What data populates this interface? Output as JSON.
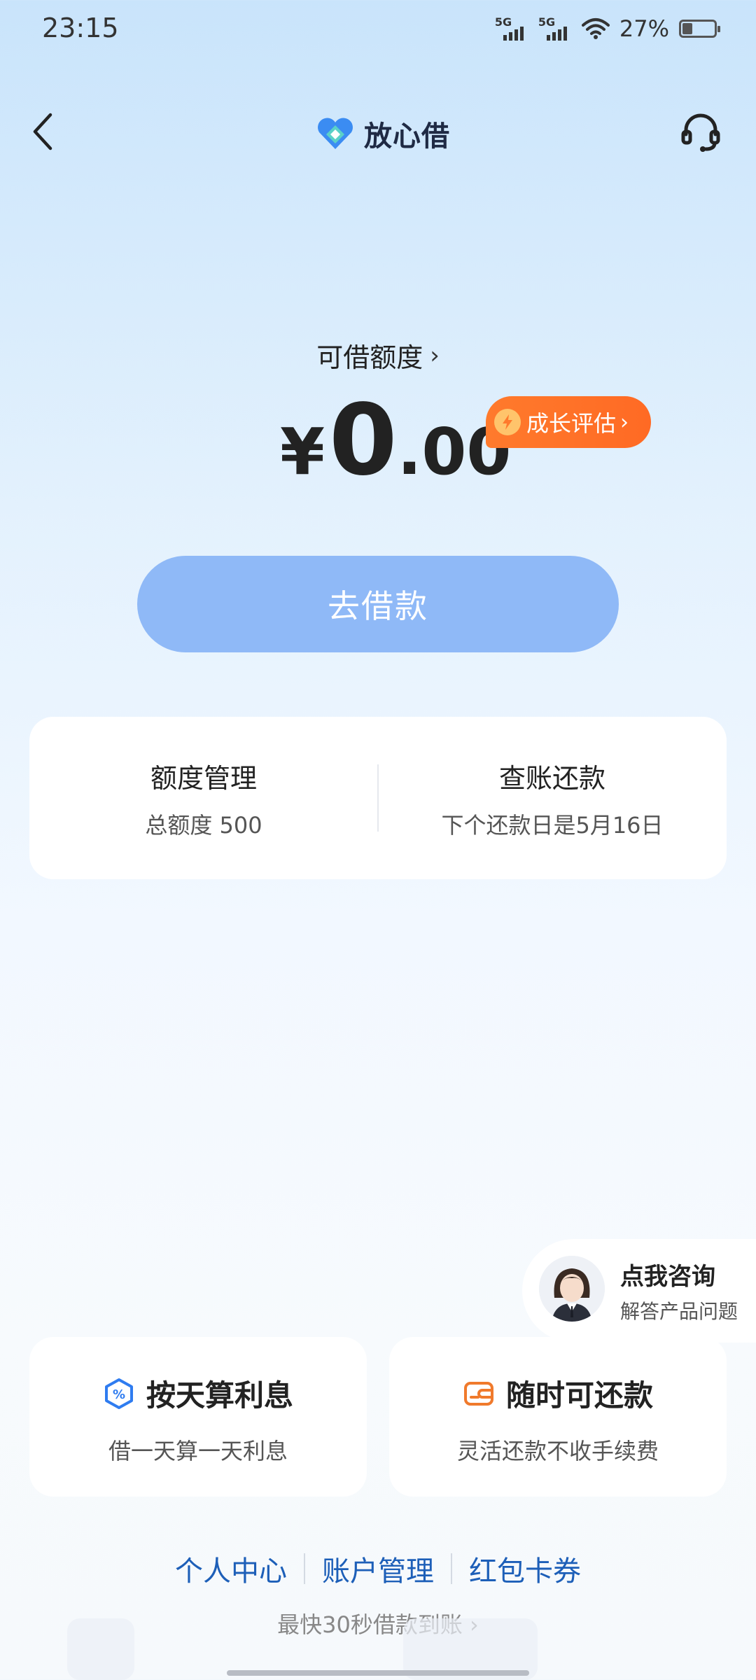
{
  "status_bar": {
    "time": "23:15",
    "signal1_label": "5G",
    "signal2_label": "5G",
    "battery_text": "27%"
  },
  "nav": {
    "brand_name": "放心借",
    "back_icon": "chevron-left-icon",
    "service_icon": "headset-icon"
  },
  "credit": {
    "label": "可借额度",
    "chevron": "›",
    "currency": "¥",
    "amount_int": "0",
    "amount_dec": ".00",
    "growth_label": "成长评估",
    "growth_chevron": "›"
  },
  "borrow_button": "去借款",
  "manage": {
    "left_title": "额度管理",
    "left_sub": "总额度 500",
    "right_title": "查账还款",
    "right_sub": "下个还款日是5月16日"
  },
  "consult": {
    "title": "点我咨询",
    "subtitle": "解答产品问题"
  },
  "features": [
    {
      "title": "按天算利息",
      "subtitle": "借一天算一天利息",
      "icon": "percent-shield-icon"
    },
    {
      "title": "随时可还款",
      "subtitle": "灵活还款不收手续费",
      "icon": "wallet-icon"
    }
  ],
  "links": {
    "personal_center": "个人中心",
    "account_management": "账户管理",
    "coupons": "红包卡券"
  },
  "tagline": "最快30秒借款到账 ›",
  "colors": {
    "accent_blue": "#1d5fb8",
    "button_blue": "#8fb9f7",
    "growth_orange": "#ff7a2c"
  }
}
